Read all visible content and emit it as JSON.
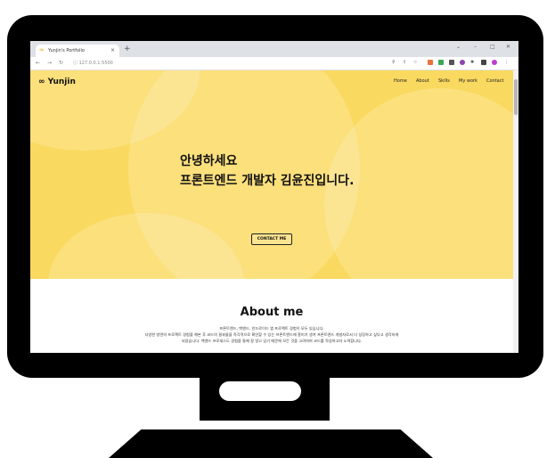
{
  "browser": {
    "tab_title": "Yunjin's Portfolio",
    "tab_icon": "∞",
    "close_glyph": "×",
    "new_tab_glyph": "+",
    "url": "127.0.0.1:5500"
  },
  "site": {
    "logo": "∞ Yunjin",
    "nav": [
      "Home",
      "About",
      "Skills",
      "My work",
      "Contact"
    ],
    "hero_line1": "안녕하세요",
    "hero_line2": "프론트엔드 개발자 김윤진입니다.",
    "contact_button": "CONTACT ME",
    "about_title": "About me",
    "about_lines": [
      "프론트엔드, 백엔드, 안드로이드 앱 프로젝트 경험이 모두 있습니다.",
      "다양한 방면의 프로젝트 경험을 해본 후 코드의 결과물을 즉각적으로 확인할 수 있는 프론트엔드에 흥미가 생겨 프론트엔드 개발자로서 더 성장하고 싶다고 생각하게",
      "되었습니다. 백엔드 프로세스도 경험을 통해 잘 알고 있기 때문에 모든 것을 고려하여 코드를 작성하고자 노력합니다."
    ]
  },
  "colors": {
    "hero_bg": "#fad960",
    "frame": "#000000"
  }
}
